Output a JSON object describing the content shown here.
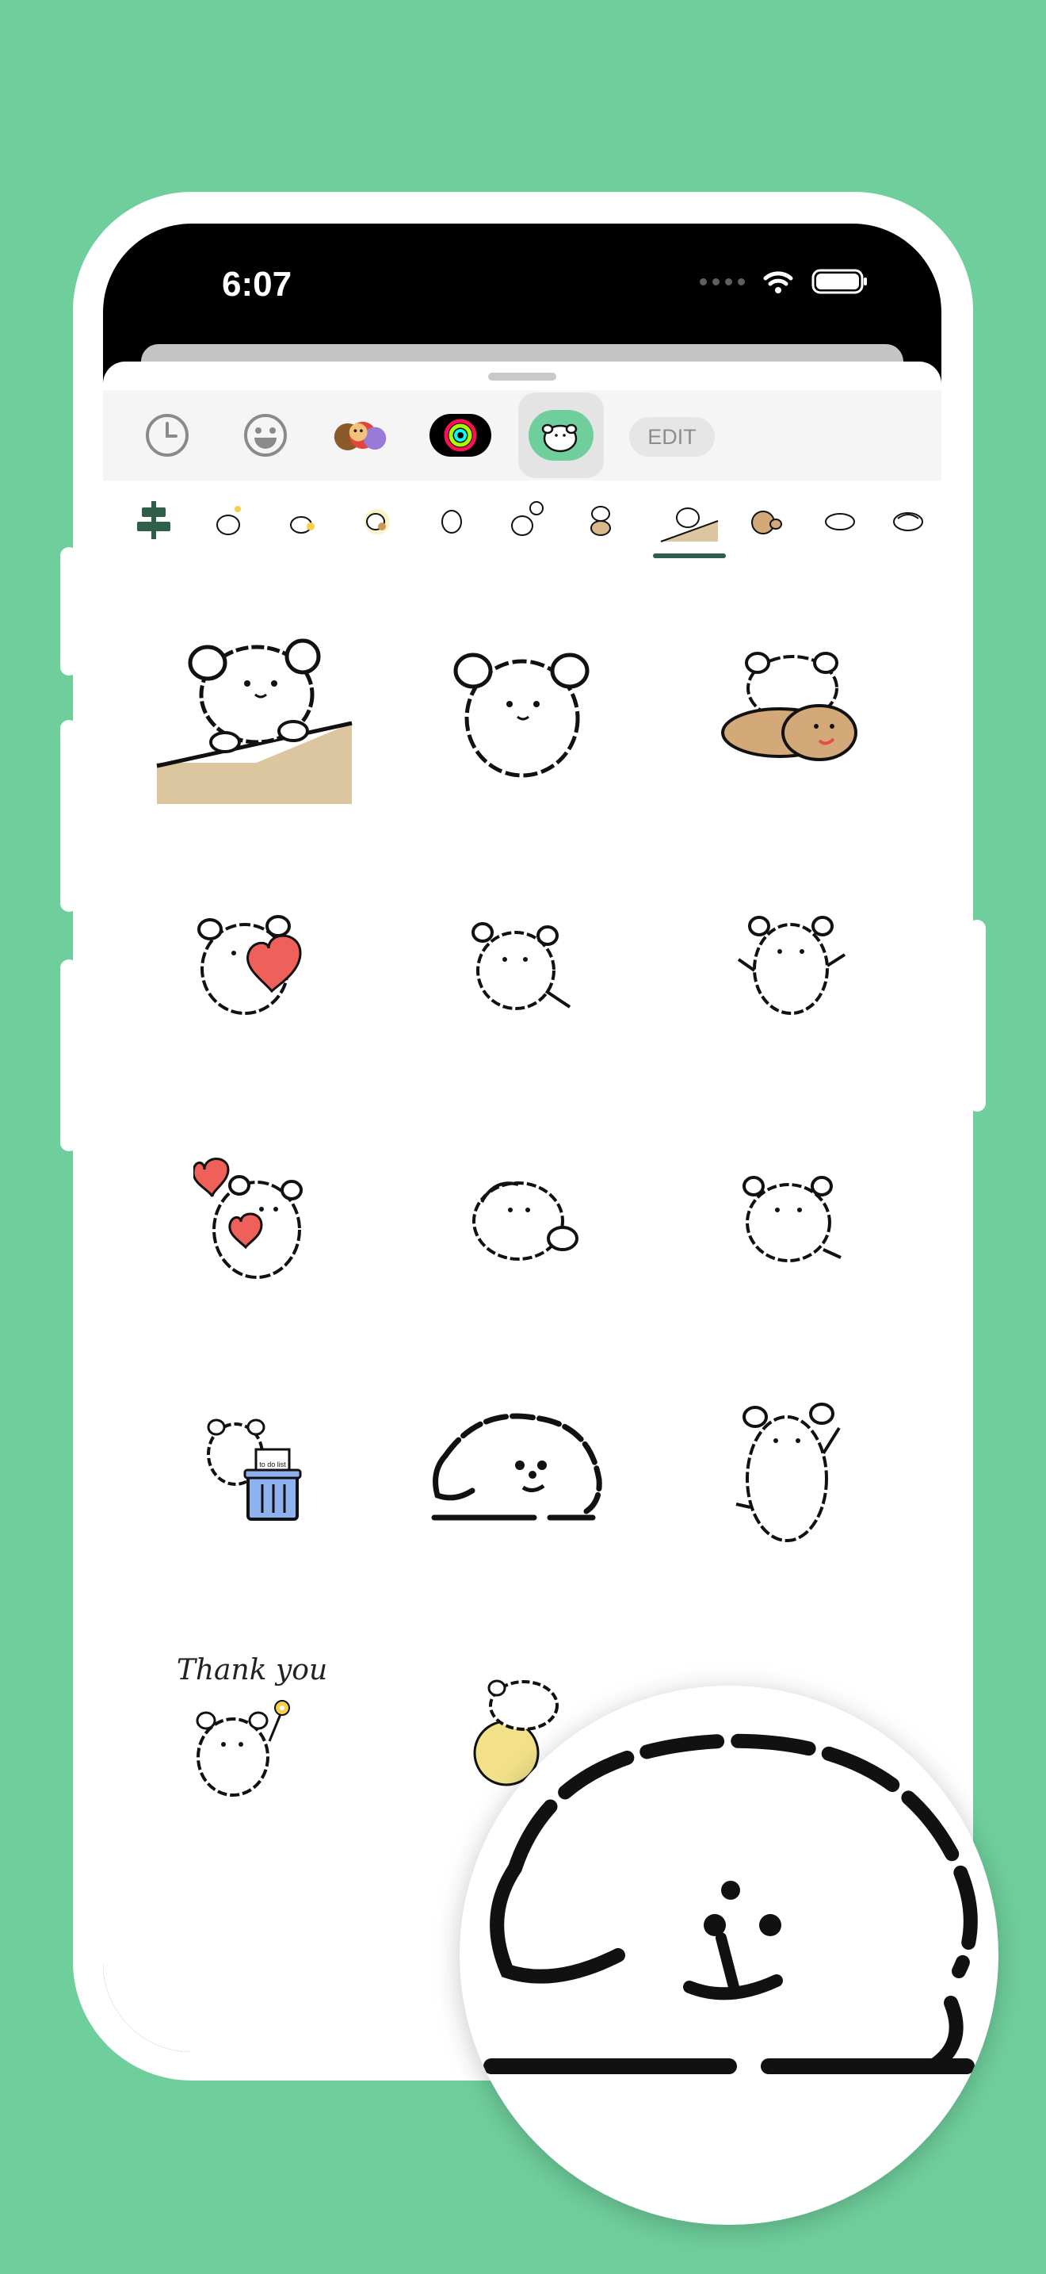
{
  "status": {
    "time": "6:07"
  },
  "sheet": {
    "edit_label": "EDIT",
    "apps": [
      {
        "name": "recent-icon"
      },
      {
        "name": "emoji-icon"
      },
      {
        "name": "memoji-stickers-icon"
      },
      {
        "name": "activity-rings-icon"
      },
      {
        "name": "dog-sticker-app-icon",
        "selected": true
      }
    ],
    "packs": [
      "pin-icon",
      "pack-1",
      "pack-2",
      "pack-3",
      "pack-4",
      "pack-5",
      "pack-6",
      "pack-7-selected",
      "pack-8",
      "pack-9",
      "pack-10"
    ],
    "selected_pack_index": 7
  },
  "stickers": {
    "thank_you_text": "Thank you",
    "todo_text": "to do list"
  },
  "colors": {
    "background": "#6fcf9c",
    "accent_green": "#2f5e4a",
    "heart_red": "#f0605a",
    "trash_blue": "#8fb1ee",
    "wall_tan": "#dcc6a0"
  }
}
